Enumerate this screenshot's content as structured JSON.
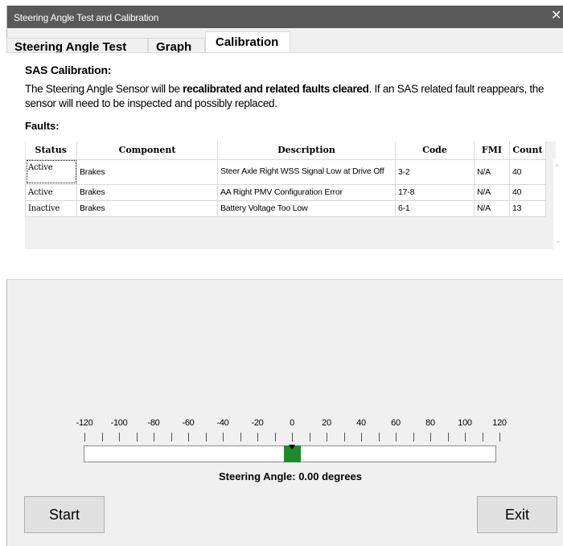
{
  "window": {
    "title": "Steering Angle Test and Calibration",
    "close_glyph": "✕"
  },
  "tabs": [
    {
      "label": "Steering Angle Test"
    },
    {
      "label": "Graph"
    },
    {
      "label": "Calibration"
    }
  ],
  "active_tab": "Calibration",
  "calibration": {
    "heading": "SAS Calibration:",
    "desc_part1": "The Steering Angle Sensor will be ",
    "desc_bold": "recalibrated and related faults cleared",
    "desc_part2": ". If an SAS related fault reappears, the sensor will need to be inspected and possibly replaced.",
    "faults_heading": "Faults:"
  },
  "faults_table": {
    "columns": [
      "Status",
      "Component",
      "Description",
      "Code",
      "FMI",
      "Count"
    ],
    "rows": [
      {
        "status": "Active",
        "component": "Brakes",
        "description": "Steer Axle Right WSS Signal Low at Drive Off",
        "code": "3-2",
        "fmi": "N/A",
        "count": "40"
      },
      {
        "status": "Active",
        "component": "Brakes",
        "description": "AA Right PMV Configuration Error",
        "code": "17-8",
        "fmi": "N/A",
        "count": "40"
      },
      {
        "status": "Inactive",
        "component": "Brakes",
        "description": "Battery Voltage Too Low",
        "code": "6-1",
        "fmi": "N/A",
        "count": "13"
      }
    ]
  },
  "gauge": {
    "tick_labels": [
      "-120",
      "-100",
      "-80",
      "-60",
      "-40",
      "-20",
      "0",
      "20",
      "40",
      "60",
      "80",
      "100",
      "120"
    ],
    "min": -120,
    "max": 120,
    "value": 0.0,
    "indicator_color": "#1e8a2b",
    "readout": "Steering Angle: 0.00 degrees"
  },
  "buttons": {
    "start": "Start",
    "exit": "Exit"
  }
}
